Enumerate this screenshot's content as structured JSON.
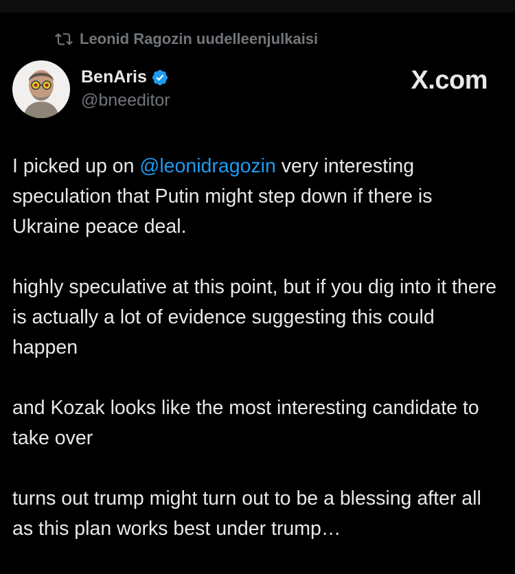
{
  "repost": {
    "text": "Leonid Ragozin uudelleenjulkaisi",
    "icon": "repost-icon"
  },
  "author": {
    "name": "BenAris",
    "handle": "@bneeditor",
    "verified": true,
    "avatar_icon": "profile-avatar"
  },
  "brand": {
    "text": "X.com"
  },
  "tweet": {
    "p1_before": "I picked up on ",
    "p1_mention": "@leonidragozin",
    "p1_after": " very interesting speculation that Putin might step down if there is Ukraine peace deal.",
    "p2": "highly speculative at this point, but if you dig into it there is actually a lot of evidence suggesting this could happen",
    "p3": "and Kozak looks like the most interesting candidate to take over",
    "p4": "turns out trump might turn out to be a blessing after all as this plan works best under trump…"
  },
  "colors": {
    "background": "#000000",
    "text": "#e7e9ea",
    "muted": "#71767b",
    "link": "#1d9bf0",
    "verified": "#1d9bf0"
  }
}
